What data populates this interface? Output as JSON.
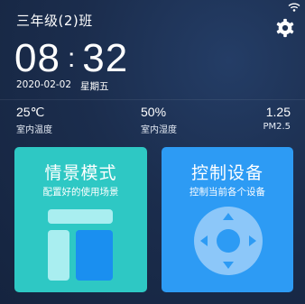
{
  "header": {
    "class_name": "三年级(2)班"
  },
  "clock": {
    "hour": "08",
    "sep": ":",
    "minute": "32",
    "date": "2020-02-02",
    "weekday": "星期五"
  },
  "stats": [
    {
      "value": "25℃",
      "label": "室内温度"
    },
    {
      "value": "50%",
      "label": "室内湿度"
    },
    {
      "value": "1.25",
      "label": "PM2.5"
    }
  ],
  "cards": {
    "scene": {
      "title": "情景模式",
      "subtitle": "配置好的使用场景",
      "color": "#2ec8c4"
    },
    "control": {
      "title": "控制设备",
      "subtitle": "控制当前各个设备",
      "color": "#2d9bf4"
    }
  },
  "icons": [
    "wifi-icon",
    "gear-icon",
    "scene-layout-icon",
    "remote-control-icon"
  ]
}
